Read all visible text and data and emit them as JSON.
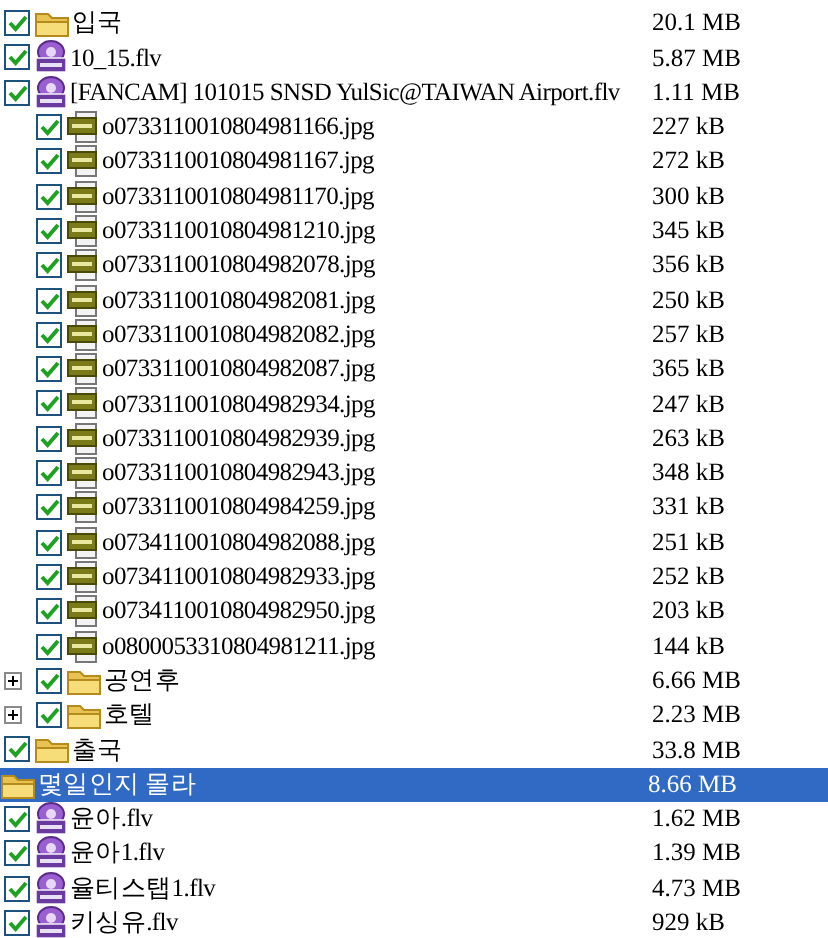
{
  "tree": [
    {
      "name": "입국",
      "size": "20.1 MB",
      "kind": "folder",
      "checked": true,
      "selected": false
    },
    {
      "name": "10_15.flv",
      "size": "5.87 MB",
      "kind": "flv",
      "checked": true,
      "selected": false
    },
    {
      "name": "[FANCAM] 101015 SNSD YulSic@TAIWAN Airport.flv",
      "size": "1.11 MB",
      "kind": "flv",
      "checked": true,
      "selected": false,
      "children": [
        {
          "name": "o0733110010804981166.jpg",
          "size": "227 kB",
          "kind": "jpg",
          "checked": true,
          "selected": false
        },
        {
          "name": "o0733110010804981167.jpg",
          "size": "272 kB",
          "kind": "jpg",
          "checked": true,
          "selected": false
        },
        {
          "name": "o0733110010804981170.jpg",
          "size": "300 kB",
          "kind": "jpg",
          "checked": true,
          "selected": false
        },
        {
          "name": "o0733110010804981210.jpg",
          "size": "345 kB",
          "kind": "jpg",
          "checked": true,
          "selected": false
        },
        {
          "name": "o0733110010804982078.jpg",
          "size": "356 kB",
          "kind": "jpg",
          "checked": true,
          "selected": false
        },
        {
          "name": "o0733110010804982081.jpg",
          "size": "250 kB",
          "kind": "jpg",
          "checked": true,
          "selected": false
        },
        {
          "name": "o0733110010804982082.jpg",
          "size": "257 kB",
          "kind": "jpg",
          "checked": true,
          "selected": false
        },
        {
          "name": "o0733110010804982087.jpg",
          "size": "365 kB",
          "kind": "jpg",
          "checked": true,
          "selected": false
        },
        {
          "name": "o0733110010804982934.jpg",
          "size": "247 kB",
          "kind": "jpg",
          "checked": true,
          "selected": false
        },
        {
          "name": "o0733110010804982939.jpg",
          "size": "263 kB",
          "kind": "jpg",
          "checked": true,
          "selected": false
        },
        {
          "name": "o0733110010804982943.jpg",
          "size": "348 kB",
          "kind": "jpg",
          "checked": true,
          "selected": false
        },
        {
          "name": "o0733110010804984259.jpg",
          "size": "331 kB",
          "kind": "jpg",
          "checked": true,
          "selected": false
        },
        {
          "name": "o0734110010804982088.jpg",
          "size": "251 kB",
          "kind": "jpg",
          "checked": true,
          "selected": false
        },
        {
          "name": "o0734110010804982933.jpg",
          "size": "252 kB",
          "kind": "jpg",
          "checked": true,
          "selected": false
        },
        {
          "name": "o0734110010804982950.jpg",
          "size": "203 kB",
          "kind": "jpg",
          "checked": true,
          "selected": false
        },
        {
          "name": "o0800053310804981211.jpg",
          "size": "144 kB",
          "kind": "jpg",
          "checked": true,
          "selected": false
        },
        {
          "name": "공연후",
          "size": "6.66 MB",
          "kind": "folder",
          "checked": true,
          "expanded": false,
          "selected": false
        },
        {
          "name": "호텔",
          "size": "2.23 MB",
          "kind": "folder",
          "checked": true,
          "expanded": false,
          "selected": false
        }
      ]
    },
    {
      "name": "출국",
      "size": "33.8 MB",
      "kind": "folder",
      "checked": true,
      "selected": false
    },
    {
      "name": "몇일인지 몰라",
      "size": "8.66 MB",
      "kind": "folder",
      "selected": true
    },
    {
      "name": "윤아.flv",
      "size": "1.62 MB",
      "kind": "flv",
      "checked": true,
      "selected": false
    },
    {
      "name": "윤아1.flv",
      "size": "1.39 MB",
      "kind": "flv",
      "checked": true,
      "selected": false
    },
    {
      "name": "율티스탭1.flv",
      "size": "4.73 MB",
      "kind": "flv",
      "checked": true,
      "selected": false
    },
    {
      "name": "키싱유.flv",
      "size": "929 kB",
      "kind": "flv",
      "checked": true,
      "selected": false
    }
  ]
}
